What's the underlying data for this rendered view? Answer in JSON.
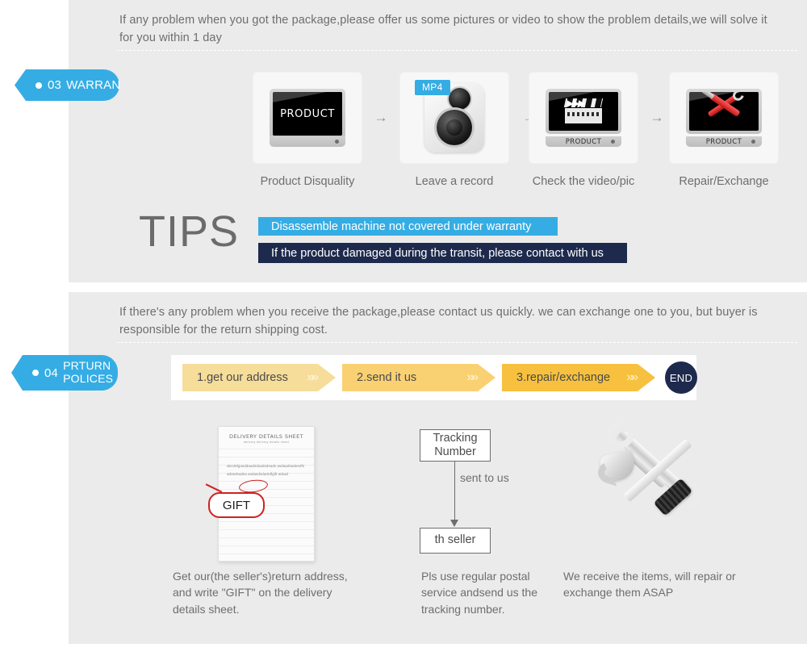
{
  "sections": {
    "warranty": {
      "tag": {
        "number": "03",
        "label": "WARRANTY"
      },
      "intro": "If any problem when you got the package,please offer us some pictures or video to show the problem details,we will solve it for you within 1 day",
      "steps": [
        {
          "label": "Product Disquality",
          "icon": "monitor-product-icon",
          "screen_text": "PRODUCT"
        },
        {
          "label": "Leave a record",
          "icon": "camera-recorder-icon",
          "badge": "MP4"
        },
        {
          "label": "Check the video/pic",
          "icon": "monitor-clapperboard-icon",
          "screen_text": "PRODUCT"
        },
        {
          "label": "Repair/Exchange",
          "icon": "monitor-tools-icon",
          "screen_text": "PRODUCT"
        }
      ],
      "arrow_glyph": "→",
      "tips": {
        "heading": "TIPS",
        "bars": [
          {
            "text": "Disassemble machine not covered under warranty",
            "color": "#35ade4"
          },
          {
            "text": "If the product damaged during the transit, please contact with us",
            "color": "#1d2a4d"
          }
        ]
      }
    },
    "returns": {
      "tag": {
        "number": "04",
        "line1": "PRTURN",
        "line2": "POLICES"
      },
      "intro": "If  there's any problem when you receive the package,please contact us quickly. we can exchange one to you, but buyer is responsible for the return shipping cost.",
      "steps": [
        {
          "label": "1.get our address",
          "color": "#f7dd9a",
          "glyphs": "»»"
        },
        {
          "label": "2.send it us",
          "color": "#fad172",
          "glyphs": "»»"
        },
        {
          "label": "3.repair/exchange",
          "color": "#f7c13f",
          "glyphs": "»»"
        }
      ],
      "end_badge": "END",
      "columns": [
        {
          "art": "delivery-details-sheet",
          "sheet": {
            "title": "DELIVERY DETAILS SHEET",
            "subtitle": "delivery        delivery details sheet",
            "body": "abcdefgasddaadsdaadsdsads asdaadsadeedfsadasdsadsa asdasdsdadrdfgift adsad",
            "bubble": "GIFT"
          },
          "caption": "Get our(the seller's)return address, and write \"GIFT\" on the delivery details sheet."
        },
        {
          "art": "tracking-flowchart",
          "flow": {
            "top_box": "Tracking Number",
            "edge_label": "sent to us",
            "bottom_box": "th seller"
          },
          "caption": "Pls use regular postal service andsend us the  tracking number."
        },
        {
          "art": "hammer-wrench-screwdriver",
          "caption": "We receive the items, will repair or exchange  them ASAP"
        }
      ]
    }
  },
  "colors": {
    "panel_bg": "#ebebeb",
    "accent_blue": "#35ade4",
    "navy": "#1d2a4d",
    "yellow_light": "#f7dd9a",
    "yellow_mid": "#fad172",
    "yellow_dark": "#f7c13f",
    "text_gray": "#6e6e6e"
  }
}
